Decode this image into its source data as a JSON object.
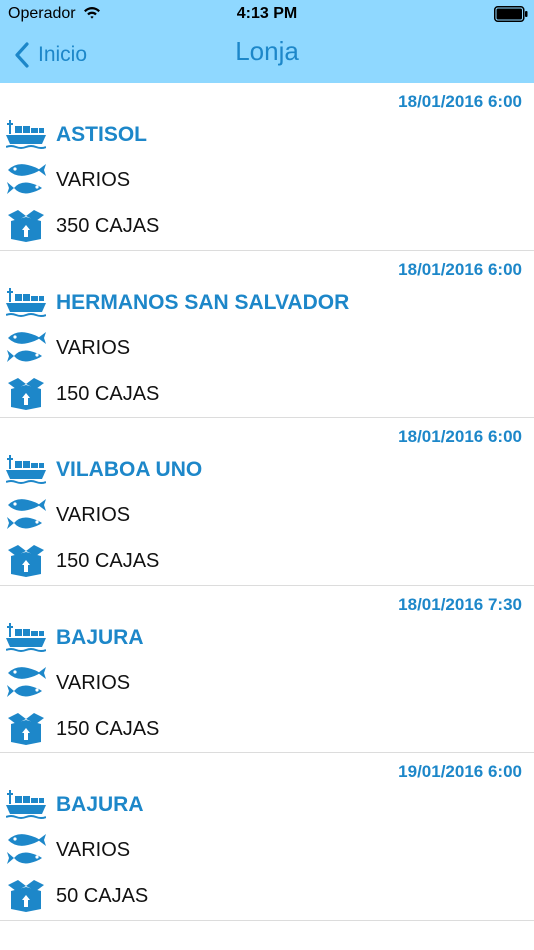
{
  "status_bar": {
    "carrier": "Operador",
    "time": "4:13 PM"
  },
  "nav": {
    "back_label": "Inicio",
    "title": "Lonja"
  },
  "colors": {
    "header_bg": "#8fd8ff",
    "accent": "#1d87c9"
  },
  "icons": {
    "vessel": "boat-icon",
    "species": "fish-icon",
    "quantity": "box-icon"
  },
  "entries": [
    {
      "date": "18/01/2016 6:00",
      "vessel": "ASTISOL",
      "species": "VARIOS",
      "quantity": "350 CAJAS"
    },
    {
      "date": "18/01/2016 6:00",
      "vessel": "HERMANOS SAN SALVADOR",
      "species": "VARIOS",
      "quantity": "150 CAJAS"
    },
    {
      "date": "18/01/2016 6:00",
      "vessel": "VILABOA UNO",
      "species": "VARIOS",
      "quantity": "150 CAJAS"
    },
    {
      "date": "18/01/2016 7:30",
      "vessel": "BAJURA",
      "species": "VARIOS",
      "quantity": "150 CAJAS"
    },
    {
      "date": "19/01/2016 6:00",
      "vessel": "BAJURA",
      "species": "VARIOS",
      "quantity": "50 CAJAS"
    }
  ]
}
